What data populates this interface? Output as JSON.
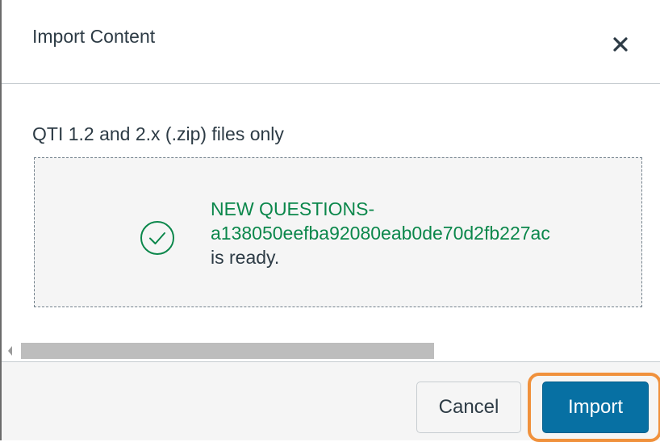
{
  "dialog": {
    "title": "Import Content",
    "close_icon": "close-icon"
  },
  "body": {
    "file_hint": "QTI 1.2 and 2.x (.zip) files only",
    "file_status": {
      "icon": "check-circle-icon",
      "name_line1": "NEW QUESTIONS-",
      "name_line2": "a138050eefba92080eab0de70d2fb227ac",
      "status": "is ready.",
      "success_color": "#0b874b"
    }
  },
  "footer": {
    "cancel_label": "Cancel",
    "import_label": "Import",
    "primary_color": "#0770a3",
    "highlight_color": "#f0913c"
  }
}
